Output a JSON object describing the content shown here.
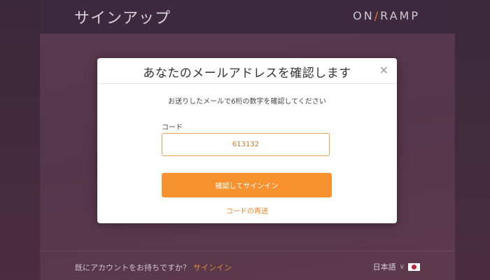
{
  "header": {
    "title": "サインアップ",
    "brand_left": "ON",
    "brand_slash": "/",
    "brand_right": "RAMP"
  },
  "modal": {
    "title": "あなたのメールアドレスを確認します",
    "close_label": "✕",
    "subtitle": "お送りしたメールで6桁の数字を確認してください",
    "code_label": "コード",
    "code_value": "613132",
    "submit_label": "確認してサインイン",
    "resend_label": "コードの再送"
  },
  "footer": {
    "prompt": "既にアカウントをお持ちですか？",
    "signin_label": "サインイン",
    "language": "日本語",
    "language_chevron": "∨"
  },
  "colors": {
    "accent": "#f7922f",
    "brand_slash": "#e07a3a",
    "flag_circle": "#c0223b"
  }
}
